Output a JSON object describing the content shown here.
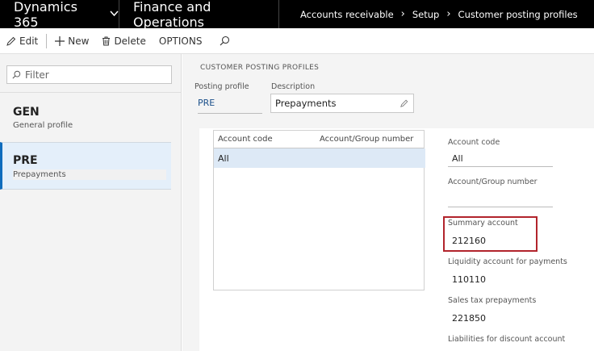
{
  "topbar": {
    "brand": "Dynamics 365",
    "module": "Finance and Operations",
    "breadcrumbs": [
      "Accounts receivable",
      "Setup",
      "Customer posting profiles"
    ]
  },
  "toolbar": {
    "edit": "Edit",
    "new": "New",
    "delete": "Delete",
    "options": "OPTIONS"
  },
  "filter": {
    "placeholder": "Filter"
  },
  "list": [
    {
      "code": "GEN",
      "description": "General profile"
    },
    {
      "code": "PRE",
      "description": "Prepayments"
    }
  ],
  "header": {
    "section_title": "CUSTOMER POSTING PROFILES",
    "posting_profile_label": "Posting profile",
    "posting_profile_value": "PRE",
    "description_label": "Description",
    "description_value": "Prepayments"
  },
  "grid": {
    "columns": [
      "Account code",
      "Account/Group number"
    ],
    "rows": [
      {
        "account_code": "All",
        "account_group_number": ""
      }
    ]
  },
  "details": {
    "account_code_label": "Account code",
    "account_code_value": "All",
    "account_group_label": "Account/Group number",
    "account_group_value": "",
    "summary_label": "Summary account",
    "summary_value": "212160",
    "liquidity_label": "Liquidity account for payments",
    "liquidity_value": "110110",
    "sales_tax_label": "Sales tax prepayments",
    "sales_tax_value": "221850",
    "liabilities_label": "Liabilities for discount account"
  },
  "colors": {
    "topbar_bg": "#000000",
    "selected_bg": "#e4effa",
    "accent": "#0f6cbd",
    "highlight_border": "#b2242c"
  }
}
